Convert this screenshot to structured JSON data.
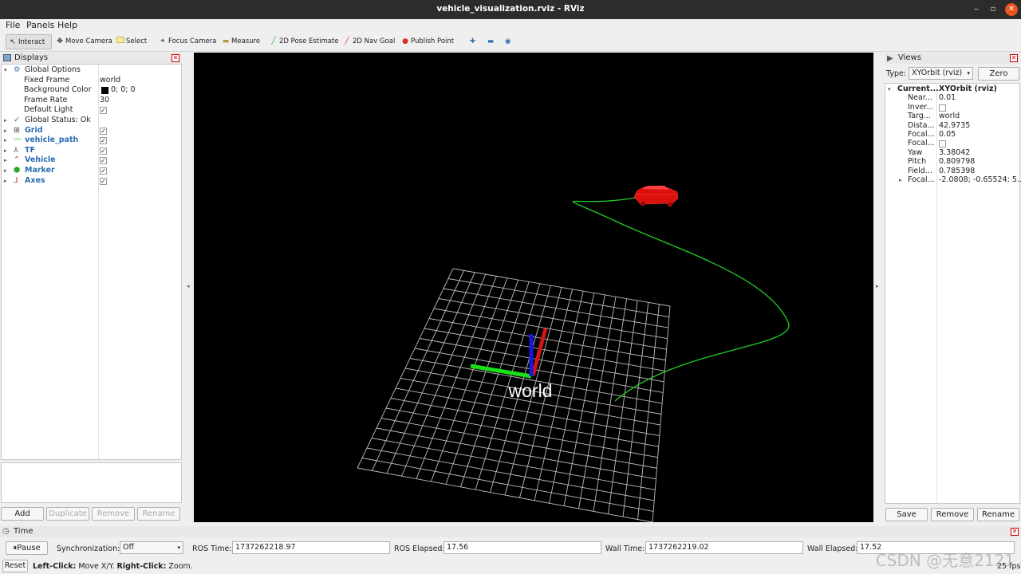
{
  "window": {
    "title": "vehicle_visualization.rviz - RViz",
    "minimize": "‒",
    "maximize": "▫",
    "close": "✕"
  },
  "menu": [
    "File",
    "Panels",
    "Help"
  ],
  "toolbar": {
    "interact": "Interact",
    "move_camera": "Move Camera",
    "select": "Select",
    "focus_camera": "Focus Camera",
    "measure": "Measure",
    "pose_estimate": "2D Pose Estimate",
    "nav_goal": "2D Nav Goal",
    "publish_point": "Publish Point"
  },
  "displays": {
    "title": "Displays",
    "global_options": "Global Options",
    "options": [
      {
        "key": "Fixed Frame",
        "value": "world"
      },
      {
        "key": "Background Color",
        "value": "0; 0; 0"
      },
      {
        "key": "Frame Rate",
        "value": "30"
      },
      {
        "key": "Default Light",
        "value": "✓"
      }
    ],
    "global_status": "Global Status: Ok",
    "items": [
      {
        "label": "Grid",
        "checked": "✓",
        "color": "#4a4a4a"
      },
      {
        "label": "vehicle_path",
        "checked": "✓",
        "color": "#22c022"
      },
      {
        "label": "TF",
        "checked": "✓",
        "color": "#555555"
      },
      {
        "label": "Vehicle",
        "checked": "✓",
        "color": "#dd2222"
      },
      {
        "label": "Marker",
        "checked": "✓",
        "color": "#22aa22"
      },
      {
        "label": "Axes",
        "checked": "✓",
        "color": "#cc2222"
      }
    ],
    "buttons": {
      "add": "Add",
      "duplicate": "Duplicate",
      "remove": "Remove",
      "rename": "Rename"
    }
  },
  "scene": {
    "frame_label": "world"
  },
  "views": {
    "title": "Views",
    "type_label": "Type:",
    "type_value": "XYOrbit (rviz)",
    "zero": "Zero",
    "current_label": "Current...",
    "current_value": "XYOrbit (rviz)",
    "props": [
      {
        "key": "Near...",
        "value": "0.01"
      },
      {
        "key": "Inver...",
        "value": ""
      },
      {
        "key": "Targ...",
        "value": "world"
      },
      {
        "key": "Dista...",
        "value": "42.9735"
      },
      {
        "key": "Focal...",
        "value": "0.05"
      },
      {
        "key": "Focal...",
        "value": ""
      },
      {
        "key": "Yaw",
        "value": "3.38042"
      },
      {
        "key": "Pitch",
        "value": "0.809798"
      },
      {
        "key": "Field...",
        "value": "0.785398"
      },
      {
        "key": "Focal...",
        "value": "-2.0808; -0.65524; 5...."
      }
    ],
    "buttons": {
      "save": "Save",
      "remove": "Remove",
      "rename": "Rename"
    }
  },
  "time": {
    "title": "Time",
    "pause": "Pause",
    "sync_label": "Synchronization:",
    "sync_value": "Off",
    "ros_time_label": "ROS Time:",
    "ros_time": "1737262218.97",
    "ros_elapsed_label": "ROS Elapsed:",
    "ros_elapsed": "17.56",
    "wall_time_label": "Wall Time:",
    "wall_time": "1737262219.02",
    "wall_elapsed_label": "Wall Elapsed:",
    "wall_elapsed": "17.52"
  },
  "status": {
    "reset": "Reset",
    "left_click": "Left-Click:",
    "left_desc": "Move X/Y.",
    "right_click": "Right-Click:",
    "right_desc": "Zoom.",
    "fps": "25 fps"
  },
  "watermark": "CSDN @无意2121"
}
